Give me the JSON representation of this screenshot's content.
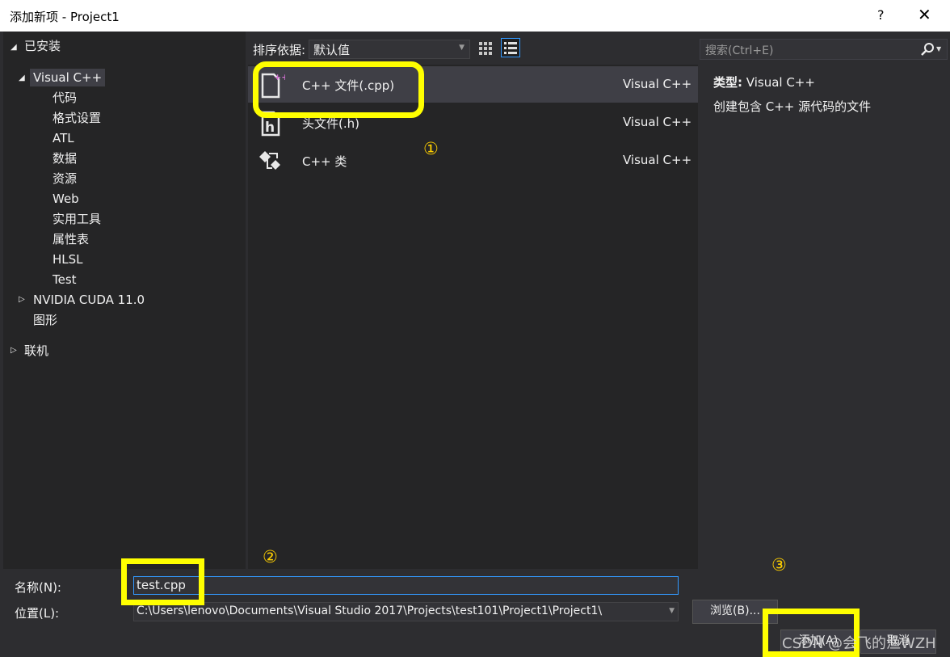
{
  "window": {
    "title": "添加新项 - Project1",
    "help_label": "?",
    "close_label": "✕"
  },
  "tree": {
    "installed": "已安装",
    "visual_cpp": "Visual C++",
    "children": [
      "代码",
      "格式设置",
      "ATL",
      "数据",
      "资源",
      "Web",
      "实用工具",
      "属性表",
      "HLSL",
      "Test"
    ],
    "nvidia": "NVIDIA CUDA 11.0",
    "graphics": "图形",
    "online": "联机"
  },
  "toolbar": {
    "sort_label": "排序依据:",
    "sort_value": "默认值"
  },
  "search": {
    "placeholder": "搜索(Ctrl+E)"
  },
  "templates": [
    {
      "name": "C++ 文件(.cpp)",
      "language": "Visual C++",
      "icon": "cpp-file-icon",
      "selected": true
    },
    {
      "name": "头文件(.h)",
      "language": "Visual C++",
      "icon": "header-file-icon",
      "selected": false
    },
    {
      "name": "C++ 类",
      "language": "Visual C++",
      "icon": "cpp-class-icon",
      "selected": false
    }
  ],
  "details": {
    "type_label": "类型:",
    "type_value": "Visual C++",
    "description": "创建包含 C++ 源代码的文件"
  },
  "form": {
    "name_label": "名称(N):",
    "name_value": "test.cpp",
    "location_label": "位置(L):",
    "location_value": "C:\\Users\\lenovo\\Documents\\Visual Studio 2017\\Projects\\test101\\Project1\\Project1\\",
    "browse_label": "浏览(B)...",
    "add_label": "添加(A)",
    "cancel_label": "取消"
  },
  "annotations": {
    "step1": "①",
    "step2": "②",
    "step3": "③",
    "highlight_color": "#ffff00"
  },
  "watermark": "CSDN @会飞的渔WZH",
  "colors": {
    "background": "#2d2d30",
    "panel": "#252526",
    "selection": "#3f3f46",
    "focus": "#3399ff"
  }
}
